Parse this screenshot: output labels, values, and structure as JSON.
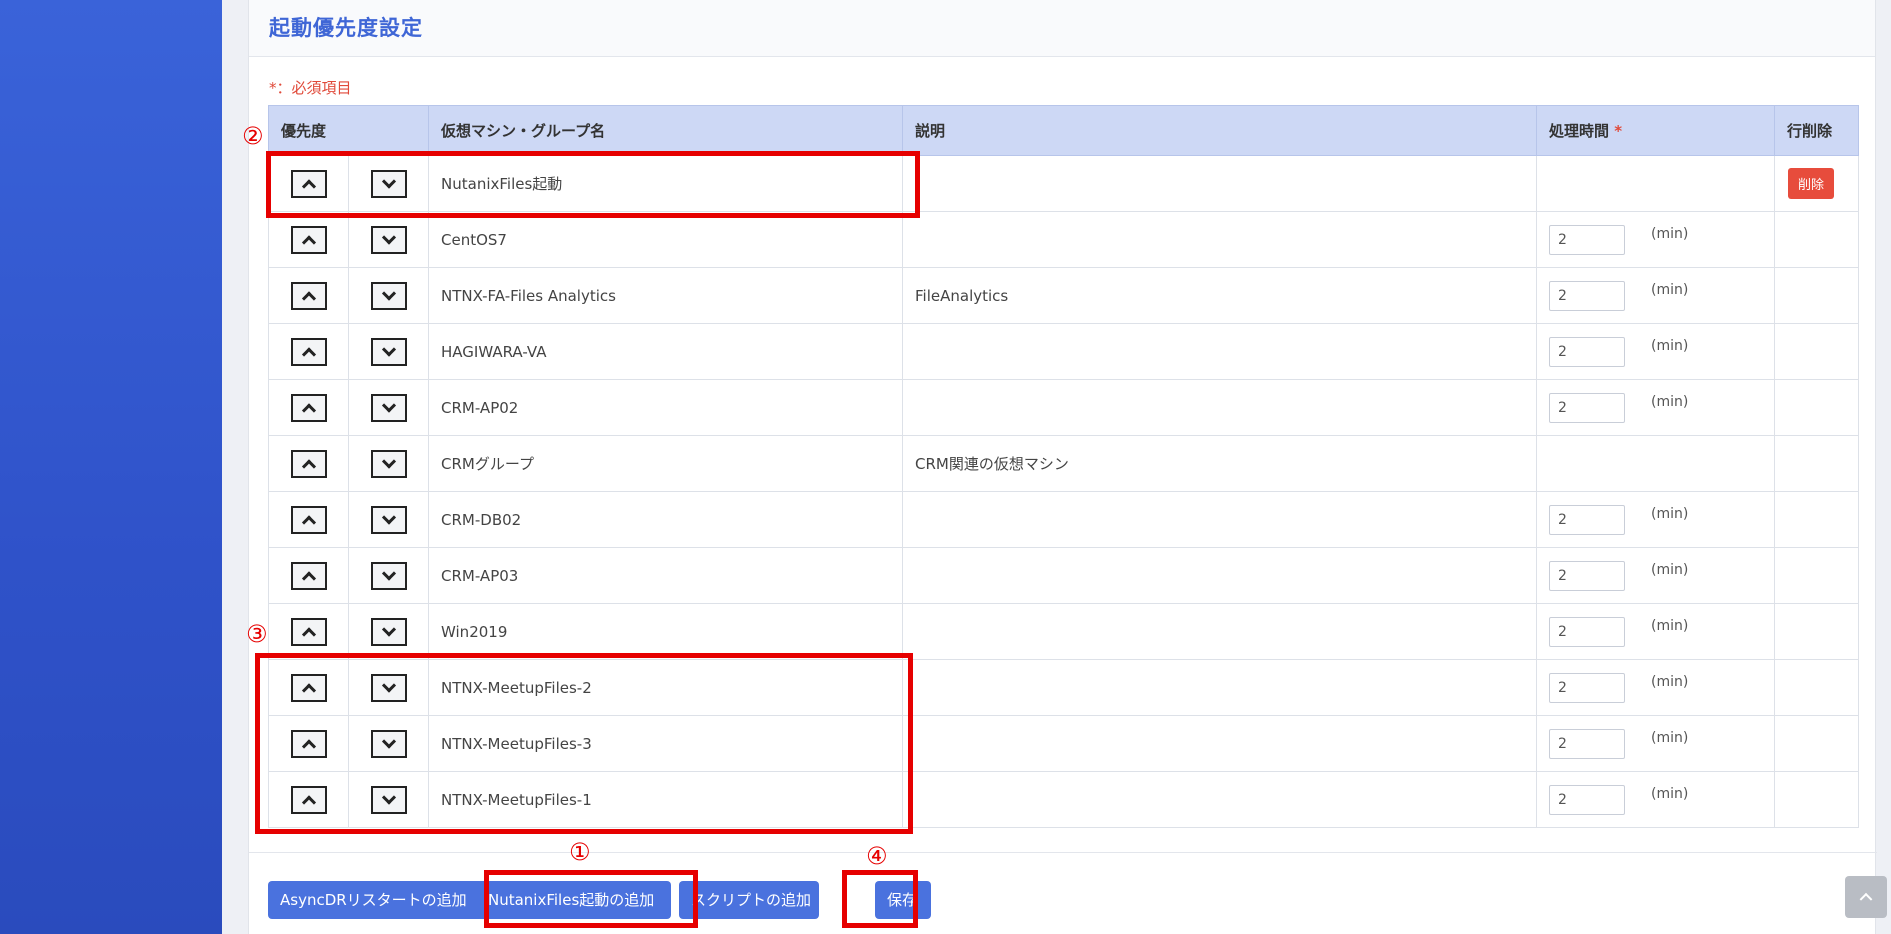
{
  "page": {
    "title": "起動優先度設定",
    "required_note": "*：必須項目"
  },
  "table": {
    "headers": {
      "priority": "優先度",
      "name": "仮想マシン・グループ名",
      "description": "説明",
      "time": "処理時間",
      "time_required_mark": "*",
      "delete": "行削除"
    },
    "unit": "(min)",
    "delete_label": "削除",
    "rows": [
      {
        "name": "NutanixFiles起動",
        "description": "",
        "time": null,
        "deletable": true
      },
      {
        "name": "CentOS7",
        "description": "",
        "time": "2",
        "deletable": false
      },
      {
        "name": "NTNX-FA-Files Analytics",
        "description": "FileAnalytics",
        "time": "2",
        "deletable": false
      },
      {
        "name": "HAGIWARA-VA",
        "description": "",
        "time": "2",
        "deletable": false
      },
      {
        "name": "CRM-AP02",
        "description": "",
        "time": "2",
        "deletable": false
      },
      {
        "name": "CRMグループ",
        "description": "CRM関連の仮想マシン",
        "time": null,
        "deletable": false
      },
      {
        "name": "CRM-DB02",
        "description": "",
        "time": "2",
        "deletable": false
      },
      {
        "name": "CRM-AP03",
        "description": "",
        "time": "2",
        "deletable": false
      },
      {
        "name": "Win2019",
        "description": "",
        "time": "2",
        "deletable": false
      },
      {
        "name": "NTNX-MeetupFiles-2",
        "description": "",
        "time": "2",
        "deletable": false
      },
      {
        "name": "NTNX-MeetupFiles-3",
        "description": "",
        "time": "2",
        "deletable": false
      },
      {
        "name": "NTNX-MeetupFiles-1",
        "description": "",
        "time": "2",
        "deletable": false
      }
    ]
  },
  "footer": {
    "add_asyncdr": "AsyncDRリスタートの追加",
    "add_nutanix_files": "NutanixFiles起動の追加",
    "add_script": "スクリプトの追加",
    "save": "保存"
  },
  "annotations": {
    "n1": "①",
    "n2": "②",
    "n3": "③",
    "n4": "④"
  },
  "colors": {
    "accent": "#4a72de",
    "sidebar": "#3a63d9",
    "highlight": "#e60000",
    "danger": "#e74c3c"
  },
  "icons": {
    "move_up": "chevron-up-icon",
    "move_down": "chevron-down-icon",
    "scroll_top": "chevron-up-icon"
  }
}
